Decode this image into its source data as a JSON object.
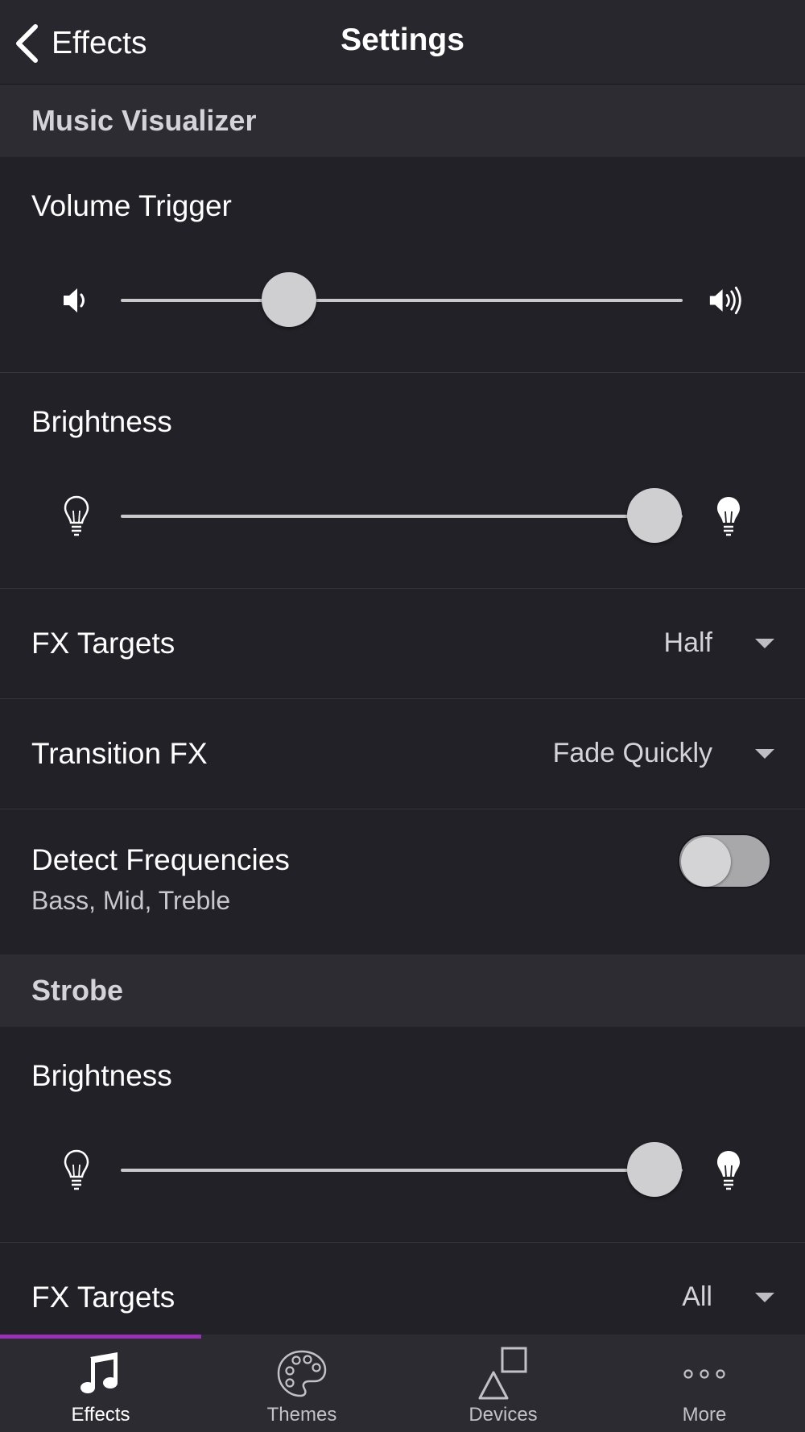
{
  "navbar": {
    "back_label": "Effects",
    "title": "Settings"
  },
  "sections": {
    "music_visualizer": {
      "header": "Music Visualizer",
      "volume_trigger": {
        "label": "Volume Trigger",
        "value_fraction": 0.3
      },
      "brightness": {
        "label": "Brightness",
        "value_fraction": 0.95
      },
      "fx_targets": {
        "label": "FX Targets",
        "value": "Half"
      },
      "transition_fx": {
        "label": "Transition FX",
        "value": "Fade Quickly"
      },
      "detect_frequencies": {
        "label": "Detect Frequencies",
        "sublabel": "Bass, Mid, Treble",
        "enabled": false
      }
    },
    "strobe": {
      "header": "Strobe",
      "brightness": {
        "label": "Brightness",
        "value_fraction": 0.95
      },
      "fx_targets": {
        "label": "FX Targets",
        "value": "All"
      }
    }
  },
  "tabs": [
    {
      "label": "Effects",
      "icon": "music-note-icon",
      "active": true
    },
    {
      "label": "Themes",
      "icon": "palette-icon",
      "active": false
    },
    {
      "label": "Devices",
      "icon": "shapes-icon",
      "active": false
    },
    {
      "label": "More",
      "icon": "ellipsis-icon",
      "active": false
    }
  ],
  "colors": {
    "background": "#222127",
    "section_header": "#2d2c33",
    "accent": "#9b2fb5"
  }
}
